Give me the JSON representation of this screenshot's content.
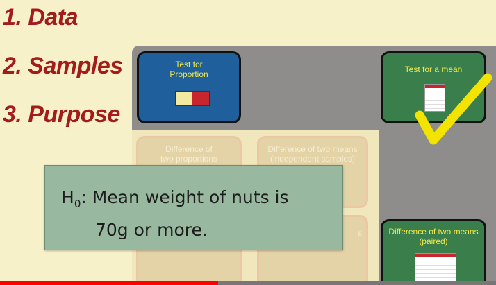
{
  "steps": [
    "1. Data",
    "2. Samples",
    "3. Purpose"
  ],
  "cards": {
    "test_proportion": "Test for\nProportion",
    "test_mean": "Test for a mean",
    "diff_proportions": "Difference of\ntwo proportions",
    "diff_means_independent": "Difference of two means\n(independent samples)",
    "diff_means_paired": "Difference of two means\n(paired)",
    "partial_label": "s"
  },
  "hypothesis": {
    "symbol": "H",
    "subscript": "0",
    "line1": ": Mean weight of nuts is",
    "line2": "70g or more."
  },
  "video_progress": 0.44,
  "colors": {
    "step_text": "#a31b1b",
    "card_blue": "#1f5f9b",
    "card_green": "#3a7e4c",
    "card_text": "#f2e94a",
    "checkmark": "#f2e300",
    "progress": "#ff0000"
  }
}
